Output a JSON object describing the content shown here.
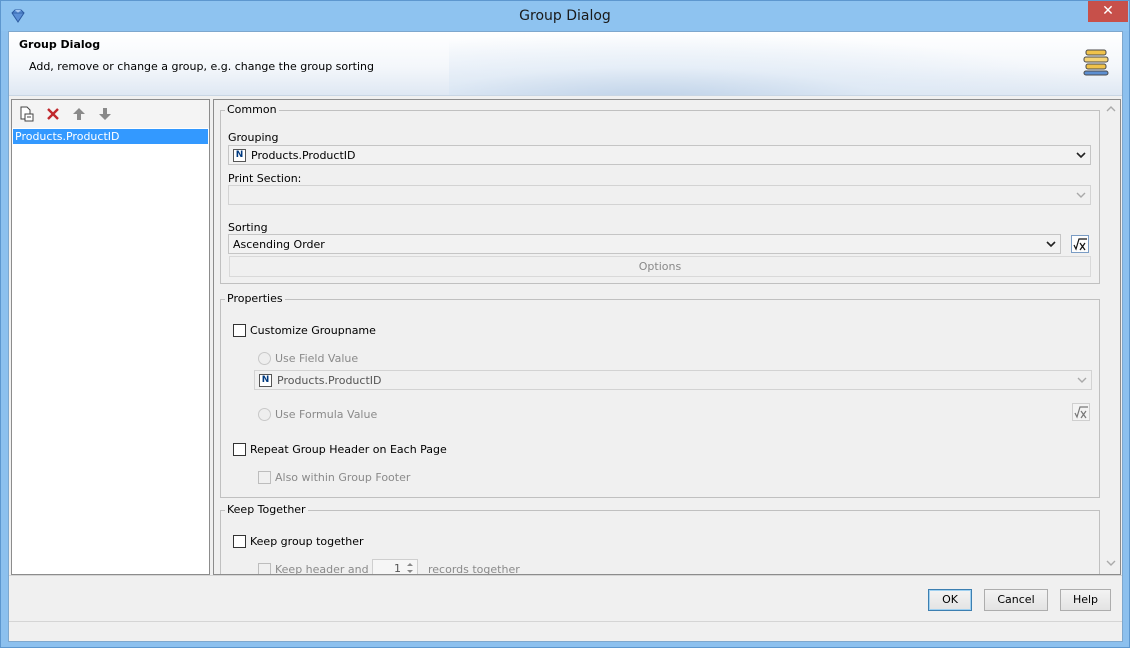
{
  "window": {
    "title": "Group Dialog",
    "close_glyph": "✕"
  },
  "header": {
    "title": "Group Dialog",
    "subtitle": "Add, remove or change a group, e.g. change the group sorting",
    "icon": "group-stack-icon"
  },
  "left": {
    "toolbar": [
      "add-group-icon",
      "delete-icon",
      "move-up-icon",
      "move-down-icon"
    ],
    "items": [
      "Products.ProductID"
    ]
  },
  "common": {
    "title": "Common",
    "grouping_label": "Grouping",
    "grouping_value": "Products.ProductID",
    "field_badge": "N",
    "print_section_label": "Print Section:",
    "print_section_value": "",
    "sorting_label": "Sorting",
    "sorting_value": "Ascending Order",
    "options_label": "Options"
  },
  "properties": {
    "title": "Properties",
    "customize_groupname": "Customize Groupname",
    "use_field_value": "Use Field Value",
    "field_value": "Products.ProductID",
    "use_formula_value": "Use Formula Value",
    "repeat_header": "Repeat Group Header on Each Page",
    "also_within_footer": "Also within Group Footer"
  },
  "keep_together": {
    "title": "Keep Together",
    "keep_group_together": "Keep group together",
    "keep_header_and": "Keep header and",
    "records_count": "1",
    "records_together": "records together"
  },
  "buttons": {
    "ok": "OK",
    "cancel": "Cancel",
    "help": "Help"
  },
  "colors": {
    "selection": "#3399ff",
    "titlebar": "#8ec3f0",
    "close": "#c7504a"
  }
}
